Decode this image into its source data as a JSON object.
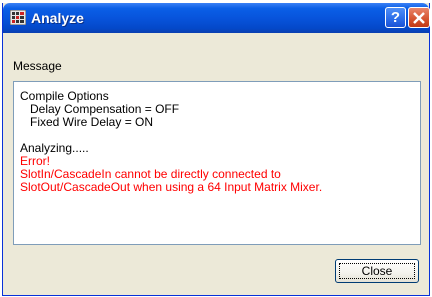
{
  "window": {
    "title": "Analyze",
    "help_glyph": "?",
    "app_icon": "matrix-app-icon",
    "accent_color": "#0854dc"
  },
  "message": {
    "label": "Message",
    "lines": [
      {
        "text": "Compile Options",
        "color": "#000000"
      },
      {
        "text": "   Delay Compensation = OFF",
        "color": "#000000"
      },
      {
        "text": "   Fixed Wire Delay = ON",
        "color": "#000000"
      },
      {
        "text": "",
        "color": "#000000"
      },
      {
        "text": "Analyzing.....",
        "color": "#000000"
      },
      {
        "text": "Error!",
        "color": "#ff0000"
      },
      {
        "text": "SlotIn/CascadeIn cannot be directly connected to",
        "color": "#ff0000"
      },
      {
        "text": "SlotOut/CascadeOut when using a 64 Input Matrix Mixer.",
        "color": "#ff0000"
      }
    ]
  },
  "buttons": {
    "close_label": "Close"
  }
}
